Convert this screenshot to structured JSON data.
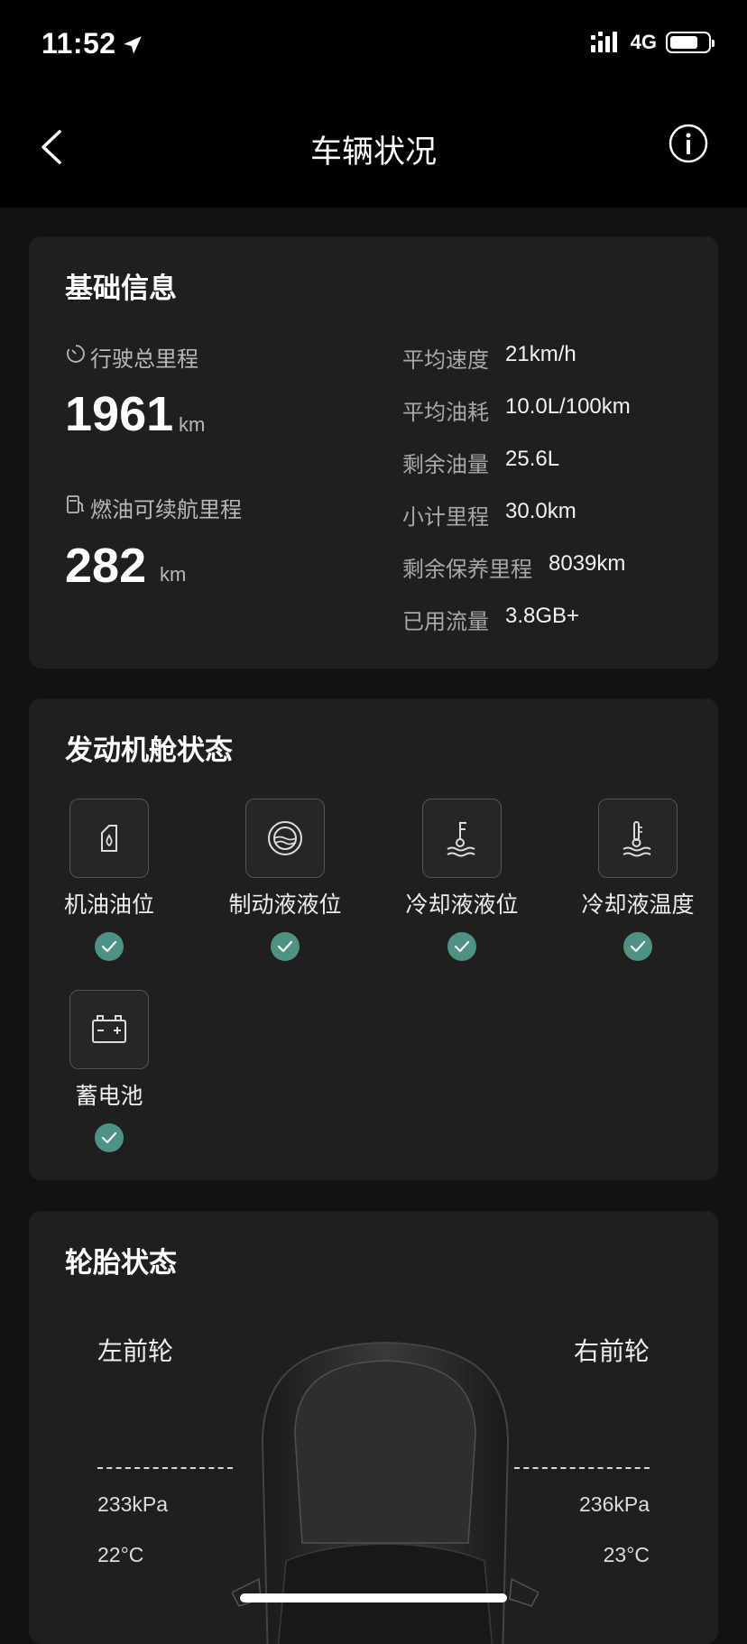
{
  "status": {
    "time": "11:52",
    "network": "4G",
    "battery_level": 0.75
  },
  "nav": {
    "title": "车辆状况"
  },
  "basic": {
    "title": "基础信息",
    "total_mileage": {
      "label": "行驶总里程",
      "value": "1961",
      "unit": "km"
    },
    "fuel_range": {
      "label": "燃油可续航里程",
      "value": "282",
      "unit": "km"
    },
    "stats": [
      {
        "label": "平均速度",
        "value": "21km/h"
      },
      {
        "label": "平均油耗",
        "value": "10.0L/100km"
      },
      {
        "label": "剩余油量",
        "value": "25.6L"
      },
      {
        "label": "小计里程",
        "value": "30.0km"
      },
      {
        "label": "剩余保养里程",
        "value": "8039km"
      },
      {
        "label": "已用流量",
        "value": "3.8GB+"
      }
    ]
  },
  "engine": {
    "title": "发动机舱状态",
    "items": [
      {
        "label": "机油油位",
        "icon": "oil-can-icon",
        "status": "ok"
      },
      {
        "label": "制动液液位",
        "icon": "brake-fluid-icon",
        "status": "ok"
      },
      {
        "label": "冷却液液位",
        "icon": "coolant-level-icon",
        "status": "ok"
      },
      {
        "label": "冷却液温度",
        "icon": "coolant-temp-icon",
        "status": "ok"
      },
      {
        "label": "蓄电池",
        "icon": "battery-icon",
        "status": "ok"
      }
    ]
  },
  "tires": {
    "title": "轮胎状态",
    "front_left": {
      "label": "左前轮",
      "pressure": "233kPa",
      "temp": "22°C"
    },
    "front_right": {
      "label": "右前轮",
      "pressure": "236kPa",
      "temp": "23°C"
    }
  },
  "colors": {
    "ok_badge": "#4d9284",
    "card_bg": "#1f1f1f",
    "page_bg": "#121212"
  }
}
